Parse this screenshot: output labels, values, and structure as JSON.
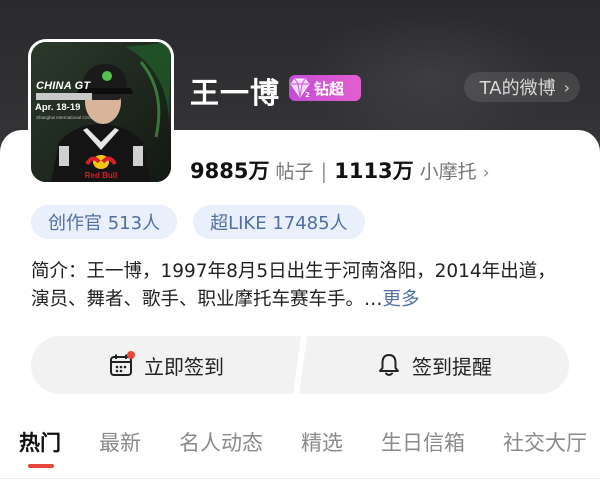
{
  "profile": {
    "name": "王一博",
    "badge_label": "钻超",
    "ta_link": "TA的微博",
    "avatar_poster": {
      "title": "CHINA GT",
      "date": "Apr. 18-19",
      "location": "Shanghai International Circuit",
      "sponsor": "Red Bull"
    }
  },
  "stats": {
    "posts_value": "9885万",
    "posts_label": "帖子",
    "separator": "|",
    "fans_value": "1113万",
    "fans_label": "小摩托"
  },
  "pills": [
    {
      "label": "创作官 513人"
    },
    {
      "label": "超LIKE 17485人"
    }
  ],
  "intro": {
    "text": "简介：王一博，1997年8月5日出生于河南洛阳，2014年出道，演员、舞者、歌手、职业摩托车赛车手。…",
    "more": "更多"
  },
  "actions": {
    "checkin": "立即签到",
    "reminder": "签到提醒"
  },
  "tabs": [
    {
      "label": "热门",
      "active": true
    },
    {
      "label": "最新"
    },
    {
      "label": "名人动态"
    },
    {
      "label": "精选"
    },
    {
      "label": "生日信箱"
    },
    {
      "label": "社交大厅"
    }
  ],
  "colors": {
    "header_bg": "#2f2f31",
    "badge": "#d455d4",
    "accent_blue": "#4f6fa5",
    "pill_bg": "#e9f0fb",
    "tab_indicator": "#e8473b"
  }
}
